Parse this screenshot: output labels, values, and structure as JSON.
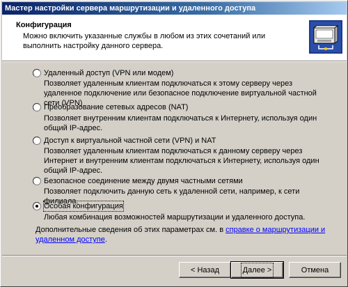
{
  "window": {
    "title": "Мастер настройки сервера маршрутизации и удаленного доступа"
  },
  "header": {
    "title": "Конфигурация",
    "description": "Можно включить указанные службы в любом из этих сочетаний или выполнить настройку данного сервера.",
    "icon": "network-server-icon"
  },
  "options": [
    {
      "label": "Удаленный доступ (VPN или модем)",
      "description": "Позволяет удаленным клиентам подключаться к этому серверу через удаленное подключение или безопасное подключение виртуальной частной сети (VPN)",
      "selected": false
    },
    {
      "label": "Преобразование сетевых адресов (NAT)",
      "description": "Позволяет внутренним клиентам подключаться к Интернету, используя один общий IP-адрес.",
      "selected": false
    },
    {
      "label": "Доступ к виртуальной частной сети (VPN) и NAT",
      "description": "Позволяет удаленным клиентам подключаться к данному серверу через Интернет и внутренним клиентам подключаться к Интернету, используя один общий IP-адрес.",
      "selected": false
    },
    {
      "label": "Безопасное соединение между двумя частными сетями",
      "description": "Позволяет подключить данную сеть к удаленной сети, например, к сети филиала.",
      "selected": false
    },
    {
      "label": "Особая конфигурация",
      "description": "Любая комбинация возможностей маршрутизации и удаленного доступа.",
      "selected": true
    }
  ],
  "more_info": {
    "prefix": "Дополнительные сведения об этих параметрах см. в ",
    "link": "справке о маршрутизации и удаленном доступе",
    "suffix": "."
  },
  "buttons": {
    "back": "< Назад",
    "next": "Далее >",
    "cancel": "Отмена"
  },
  "colors": {
    "titlebar_start": "#0a246a",
    "titlebar_end": "#a6caf0",
    "face": "#d4d0c8",
    "link": "#0000ff"
  }
}
